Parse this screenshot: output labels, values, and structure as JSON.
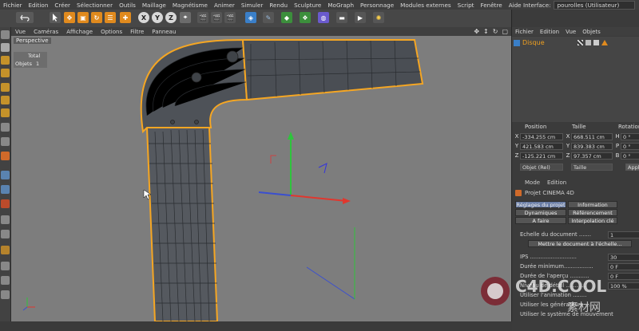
{
  "menu": {
    "items": [
      "Fichier",
      "Edition",
      "Créer",
      "Sélectionner",
      "Outils",
      "Maillage",
      "Magnétisme",
      "Animer",
      "Simuler",
      "Rendu",
      "Sculpture",
      "MoGraph",
      "Personnage",
      "Modules externes",
      "Script",
      "Fenêtre",
      "Aide"
    ],
    "interface_label": "Interface:",
    "interface_value": "pourolles (Utilisateur)"
  },
  "toolbar": {
    "icons": [
      "undo-icon",
      "select-icon",
      "move-icon",
      "scale-icon",
      "rotate-icon",
      "recent-tools-icon",
      "cross-icon",
      "x-axis-icon",
      "y-axis-icon",
      "z-axis-icon",
      "coord-system-icon",
      "render-region-icon",
      "render-view-icon",
      "render-settings-icon",
      "cube-icon",
      "pen-icon",
      "subdivide-icon",
      "array-icon",
      "deformer-icon",
      "floor-icon",
      "camera-icon",
      "light-icon"
    ],
    "axis_labels": [
      "X",
      "Y",
      "Z"
    ]
  },
  "viewport": {
    "menu": [
      "Vue",
      "Caméras",
      "Affichage",
      "Options",
      "Filtre",
      "Panneau"
    ],
    "label": "Perspective",
    "stats_header": "Total",
    "stats_row_label": "Objets",
    "stats_row_value": "1"
  },
  "object_manager": {
    "menu": [
      "Fichier",
      "Edition",
      "Vue",
      "Objets"
    ],
    "objects": [
      {
        "name": "Disque"
      }
    ]
  },
  "coordinates": {
    "headers": [
      "Position",
      "Taille",
      "Rotation"
    ],
    "rows": [
      {
        "axis": "X",
        "pos": "-334.255 cm",
        "size_axis": "X",
        "size": "668.511 cm",
        "rot_axis": "H",
        "rot": "0 °"
      },
      {
        "axis": "Y",
        "pos": "421.583 cm",
        "size_axis": "Y",
        "size": "839.383 cm",
        "rot_axis": "P",
        "rot": "0 °"
      },
      {
        "axis": "Z",
        "pos": "-125.221 cm",
        "size_axis": "Z",
        "size": "97.357 cm",
        "rot_axis": "B",
        "rot": "0 °"
      }
    ],
    "mode_left": "Objet (Rel)",
    "mode_right": "Taille",
    "apply": "Appl"
  },
  "attributes": {
    "menu": [
      "Mode",
      "Edition"
    ],
    "title": "Projet CINEMA 4D",
    "tabs": [
      {
        "label": "Réglages du projet",
        "active": true
      },
      {
        "label": "Information",
        "active": false
      },
      {
        "label": "Dynamiques",
        "active": false
      },
      {
        "label": "Référencement",
        "active": false
      },
      {
        "label": "A faire",
        "active": false
      },
      {
        "label": "Interpolation clé",
        "active": false
      }
    ],
    "properties": [
      {
        "label": "Echelle du document .......",
        "value": "1"
      },
      {
        "label": "Mettre le document à l'échelle...",
        "value": ""
      },
      {
        "label": "IPS ...........................",
        "value": "30"
      },
      {
        "label": "Durée minimum.................",
        "value": "0 F"
      },
      {
        "label": "Durée de l'aperçu ...........",
        "value": "0 F"
      },
      {
        "label": "Niveau de détail ............",
        "value": "100 %"
      },
      {
        "label": "Utiliser l'animation ........",
        "value": ""
      },
      {
        "label": "Utiliser les générateurs ....",
        "value": ""
      },
      {
        "label": "Utiliser le système de mouvement",
        "value": ""
      }
    ]
  },
  "watermark": {
    "brand": "C4D.COOL",
    "sub": "素材网"
  },
  "colors": {
    "accent": "#f0a020",
    "selection_outline": "#f5a623",
    "viewport_bg": "#7d7d7d"
  }
}
